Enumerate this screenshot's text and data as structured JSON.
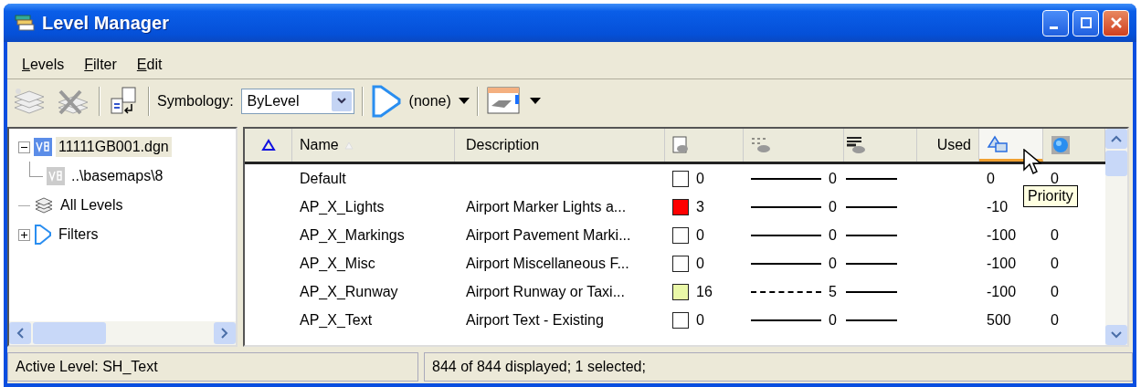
{
  "window": {
    "title": "Level Manager"
  },
  "menu": [
    {
      "mnemonic": "L",
      "rest": "evels"
    },
    {
      "mnemonic": "F",
      "rest": "ilter"
    },
    {
      "mnemonic": "E",
      "rest": "dit"
    }
  ],
  "toolbar": {
    "symbology_label": "Symbology:",
    "symbology_value": "ByLevel",
    "filter_value": "(none)"
  },
  "tree": [
    {
      "label": "11111GB001.dgn",
      "selected": true,
      "expanded": true,
      "kind": "file",
      "children": [
        {
          "label": "..\\basemaps\\8",
          "selected": false,
          "kind": "reference"
        }
      ]
    },
    {
      "label": "All Levels",
      "selected": false,
      "kind": "levels"
    },
    {
      "label": "Filters",
      "selected": false,
      "expanded": false,
      "kind": "filters"
    }
  ],
  "table": {
    "headers": {
      "name": "Name",
      "description": "Description",
      "used": "Used"
    },
    "rows": [
      {
        "name": "Default",
        "description": "",
        "color": "#ffffff",
        "color_number": "0",
        "kind": "solid",
        "style_number": "0",
        "priority": "0",
        "column_10": "0"
      },
      {
        "name": "AP_X_Lights",
        "description": "Airport Marker Lights a...",
        "color": "#ff0000",
        "color_number": "3",
        "kind": "solid",
        "style_number": "0",
        "priority": "-10"
      },
      {
        "name": "AP_X_Markings",
        "description": "Airport Pavement Marki...",
        "color": "#ffffff",
        "color_number": "0",
        "kind": "solid",
        "style_number": "0",
        "priority": "-100",
        "column_10": "0"
      },
      {
        "name": "AP_X_Misc",
        "description": "Airport Miscellaneous F...",
        "color": "#ffffff",
        "color_number": "0",
        "kind": "solid",
        "style_number": "0",
        "priority": "-100",
        "column_10": "0"
      },
      {
        "name": "AP_X_Runway",
        "description": "Airport Runway or Taxi...",
        "color": "#eaf8a8",
        "color_number": "16",
        "kind": "dashed",
        "style_number": "5",
        "priority": "-100",
        "column_10": "0"
      },
      {
        "name": "AP_X_Text",
        "description": "Airport Text - Existing",
        "color": "#ffffff",
        "color_number": "0",
        "kind": "solid",
        "style_number": "0",
        "priority": "500",
        "column_10": "0"
      }
    ]
  },
  "tooltip": "Priority",
  "status_bar": [
    "Active Level: SH_Text",
    "844 of 844 displayed; 1 selected;"
  ]
}
